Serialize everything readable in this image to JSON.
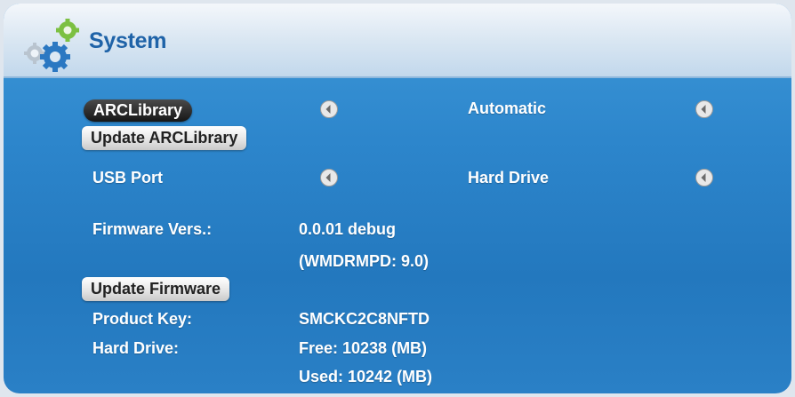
{
  "header": {
    "title": "System"
  },
  "settings": {
    "arclibrary": {
      "label": "ARCLibrary",
      "value": "Automatic"
    },
    "update_arclibrary": {
      "label": "Update ARCLibrary"
    },
    "usb_port": {
      "label": "USB Port",
      "value": "Hard Drive"
    },
    "firmware": {
      "label": "Firmware Vers.:",
      "value_line1": "0.0.01 debug",
      "value_line2": "(WMDRMPD: 9.0)"
    },
    "update_firmware": {
      "label": "Update Firmware"
    },
    "product_key": {
      "label": "Product Key:",
      "value": "SMCKC2C8NFTD"
    },
    "hard_drive": {
      "label": "Hard Drive:",
      "free": "Free: 10238 (MB)",
      "used": "Used: 10242 (MB)"
    }
  },
  "icons": {
    "logo": "gears-icon",
    "arrow": "selector-arrow-icon"
  },
  "colors": {
    "background": "#2d86cc",
    "header_title": "#1f63a8",
    "text": "#ffffff"
  }
}
